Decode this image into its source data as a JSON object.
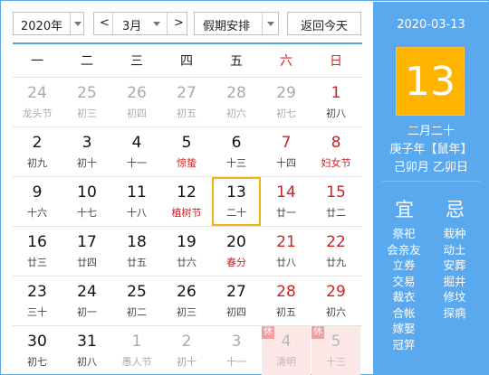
{
  "toolbar": {
    "year": "2020年",
    "prev": "<",
    "month": "3月",
    "next": ">",
    "holiday": "假期安排",
    "today_btn": "返回今天"
  },
  "weekdays": [
    "一",
    "二",
    "三",
    "四",
    "五",
    "六",
    "日"
  ],
  "weeks": [
    [
      {
        "d": "24",
        "l": "龙头节",
        "other": true
      },
      {
        "d": "25",
        "l": "初三",
        "other": true
      },
      {
        "d": "26",
        "l": "初四",
        "other": true
      },
      {
        "d": "27",
        "l": "初五",
        "other": true
      },
      {
        "d": "28",
        "l": "初六",
        "other": true
      },
      {
        "d": "29",
        "l": "初七",
        "other": true
      },
      {
        "d": "1",
        "l": "初八",
        "wkend": true
      }
    ],
    [
      {
        "d": "2",
        "l": "初九"
      },
      {
        "d": "3",
        "l": "初十"
      },
      {
        "d": "4",
        "l": "十一"
      },
      {
        "d": "5",
        "l": "惊蛰",
        "fest": true
      },
      {
        "d": "6",
        "l": "十三"
      },
      {
        "d": "7",
        "l": "十四",
        "wkend": true
      },
      {
        "d": "8",
        "l": "妇女节",
        "wkend": true,
        "fest": true
      }
    ],
    [
      {
        "d": "9",
        "l": "十六"
      },
      {
        "d": "10",
        "l": "十七"
      },
      {
        "d": "11",
        "l": "十八"
      },
      {
        "d": "12",
        "l": "植树节",
        "fest": true
      },
      {
        "d": "13",
        "l": "二十",
        "today": true
      },
      {
        "d": "14",
        "l": "廿一",
        "wkend": true
      },
      {
        "d": "15",
        "l": "廿二",
        "wkend": true
      }
    ],
    [
      {
        "d": "16",
        "l": "廿三"
      },
      {
        "d": "17",
        "l": "廿四"
      },
      {
        "d": "18",
        "l": "廿五"
      },
      {
        "d": "19",
        "l": "廿六"
      },
      {
        "d": "20",
        "l": "春分",
        "fest": true
      },
      {
        "d": "21",
        "l": "廿八",
        "wkend": true
      },
      {
        "d": "22",
        "l": "廿九",
        "wkend": true
      }
    ],
    [
      {
        "d": "23",
        "l": "三十"
      },
      {
        "d": "24",
        "l": "初一"
      },
      {
        "d": "25",
        "l": "初二"
      },
      {
        "d": "26",
        "l": "初三"
      },
      {
        "d": "27",
        "l": "初四"
      },
      {
        "d": "28",
        "l": "初五",
        "wkend": true
      },
      {
        "d": "29",
        "l": "初六",
        "wkend": true
      }
    ],
    [
      {
        "d": "30",
        "l": "初七"
      },
      {
        "d": "31",
        "l": "初八"
      },
      {
        "d": "1",
        "l": "愚人节",
        "other": true
      },
      {
        "d": "2",
        "l": "初十",
        "other": true
      },
      {
        "d": "3",
        "l": "十一",
        "other": true
      },
      {
        "d": "4",
        "l": "清明",
        "other": true,
        "rest": true,
        "badge": "休"
      },
      {
        "d": "5",
        "l": "十三",
        "other": true,
        "rest": true,
        "badge": "休"
      }
    ]
  ],
  "panel": {
    "date": "2020-03-13",
    "big_day": "13",
    "lunar": "二月二十",
    "ganzhi_year": "庚子年【鼠年】",
    "ganzhi_md": "己卯月 乙卯日",
    "yi_title": "宜",
    "ji_title": "忌",
    "yi": [
      "祭祀",
      "会亲友",
      "立券",
      "交易",
      "裁衣",
      "合帐",
      "嫁娶",
      "冠笄"
    ],
    "ji": [
      "栽种",
      "动土",
      "安葬",
      "掘井",
      "修坟",
      "探病"
    ]
  },
  "colors": {
    "accent": "#5aa8ee",
    "today_border": "#f2b312",
    "big_day_bg": "#ffb400",
    "holiday_red": "#cc2222",
    "rest_bg": "#fde8e8"
  }
}
